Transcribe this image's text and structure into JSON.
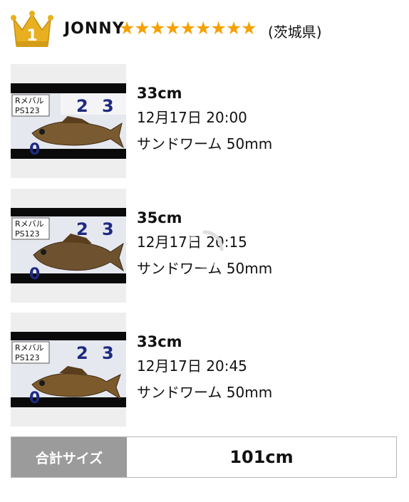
{
  "angler": {
    "rank": "1",
    "name": "JONNY",
    "stars": "★★★★★★★★★",
    "prefecture": "(茨城県)"
  },
  "catches": [
    {
      "photo_labels": [
        "Rメバル",
        "PS123"
      ],
      "size": "33cm",
      "datetime": "12月17日 20:00",
      "lure": "サンドワーム 50mm"
    },
    {
      "photo_labels": [
        "Rメバル",
        "PS123"
      ],
      "size": "35cm",
      "datetime": "12月17日 20:15",
      "lure": "サンドワーム 50mm"
    },
    {
      "photo_labels": [
        "Rメバル",
        "PS123"
      ],
      "size": "33cm",
      "datetime": "12月17日 20:45",
      "lure": "サンドワーム 50mm"
    }
  ],
  "total": {
    "label": "合計サイズ",
    "value": "101cm"
  },
  "colors": {
    "star": "#f5a100",
    "crown": "#e8b020",
    "total_label_bg": "#9b9b9b"
  }
}
